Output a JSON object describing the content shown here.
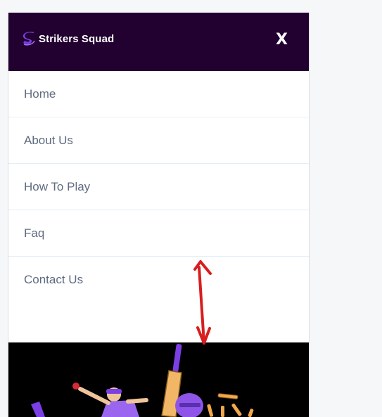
{
  "header": {
    "brand_name": "Strikers Squad",
    "close_label": "X",
    "background": "#220030"
  },
  "menu": {
    "items": [
      {
        "label": "Home"
      },
      {
        "label": "About Us"
      },
      {
        "label": "How To Play"
      },
      {
        "label": "Faq"
      },
      {
        "label": "Contact Us"
      }
    ]
  },
  "hero": {
    "icon": "cricket-illustration"
  },
  "annotation": {
    "icon": "double-headed-arrow",
    "color": "#d81e1e"
  }
}
